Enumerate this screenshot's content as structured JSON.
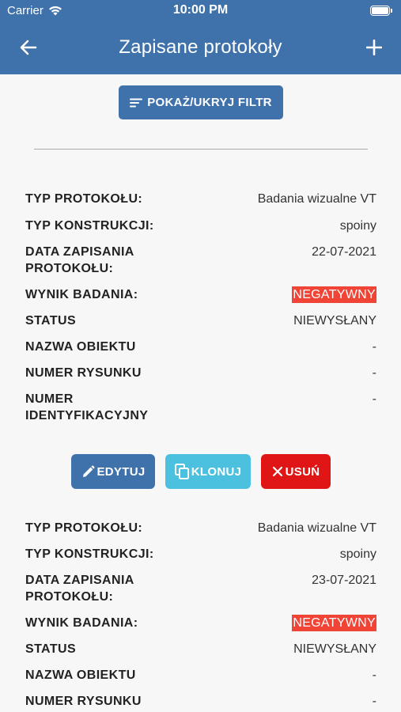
{
  "status_bar": {
    "carrier": "Carrier",
    "time": "10:00 PM"
  },
  "nav": {
    "title": "Zapisane protokoły",
    "back_icon": "arrow-left-icon",
    "add_icon": "plus-icon"
  },
  "filter_button": {
    "label": "POKAŻ/UKRYJ FILTR",
    "icon": "filter-lines-icon"
  },
  "colors": {
    "accent": "#3f71ab",
    "clone": "#4cc0df",
    "delete": "#e01515",
    "negative": "#ef4436"
  },
  "records": [
    {
      "rows": [
        {
          "label": "TYP PROTOKOŁU:",
          "value": "Badania wizualne VT"
        },
        {
          "label": "TYP KONSTRUKCJI:",
          "value": "spoiny"
        },
        {
          "label": "DATA ZAPISANIA PROTOKOŁU:",
          "value": "22-07-2021"
        },
        {
          "label": "WYNIK BADANIA:",
          "value": "NEGATYWNY"
        },
        {
          "label": "STATUS",
          "value": "NIEWYSŁANY"
        },
        {
          "label": "NAZWA OBIEKTU",
          "value": "-"
        },
        {
          "label": "NUMER RYSUNKU",
          "value": "-"
        },
        {
          "label": "NUMER IDENTYFIKACYJNY",
          "value": "-"
        }
      ],
      "actions": {
        "edit": "EDYTUJ",
        "clone": "KLONUJ",
        "delete": "USUŃ"
      }
    },
    {
      "rows": [
        {
          "label": "TYP PROTOKOŁU:",
          "value": "Badania wizualne VT"
        },
        {
          "label": "TYP KONSTRUKCJI:",
          "value": "spoiny"
        },
        {
          "label": "DATA ZAPISANIA PROTOKOŁU:",
          "value": "23-07-2021"
        },
        {
          "label": "WYNIK BADANIA:",
          "value": "NEGATYWNY"
        },
        {
          "label": "STATUS",
          "value": "NIEWYSŁANY"
        },
        {
          "label": "NAZWA OBIEKTU",
          "value": "-"
        },
        {
          "label": "NUMER RYSUNKU",
          "value": "-"
        }
      ]
    }
  ]
}
